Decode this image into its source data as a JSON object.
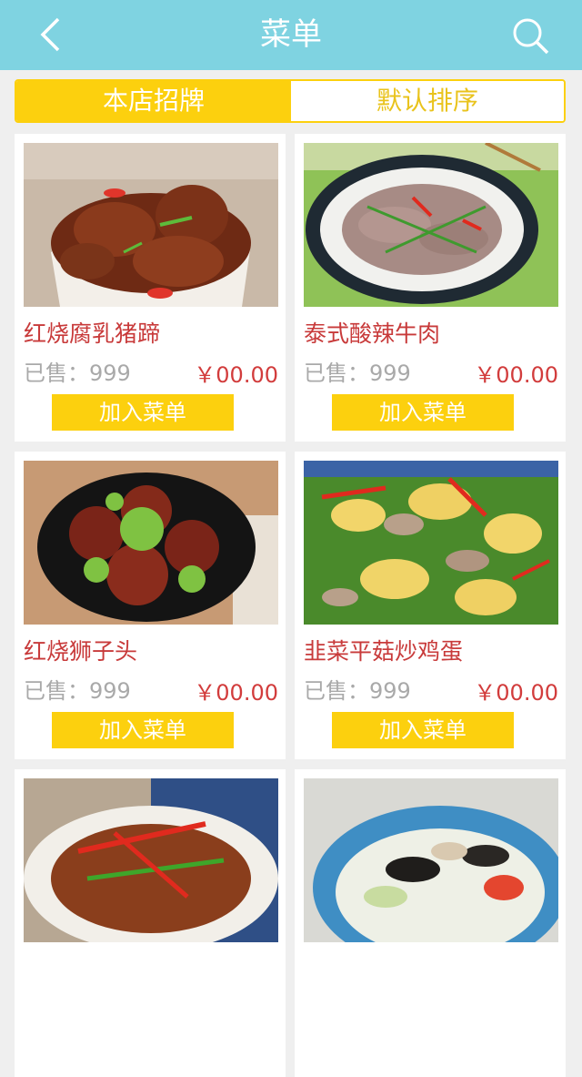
{
  "header": {
    "title": "菜单",
    "back_icon": "chevron-left-icon",
    "search_icon": "search-icon"
  },
  "tabs": [
    {
      "label": "本店招牌",
      "active": true
    },
    {
      "label": "默认排序",
      "active": false
    }
  ],
  "colors": {
    "header": "#7fd3e1",
    "accent": "#fcd00e",
    "name": "#c83a3a",
    "price": "#d23c3c",
    "muted": "#a9a9a9"
  },
  "dishes": [
    {
      "name": "红烧腐乳猪蹄",
      "sold": "已售：999",
      "price": "￥00.00",
      "button": "加入菜单"
    },
    {
      "name": "泰式酸辣牛肉",
      "sold": "已售：999",
      "price": "￥00.00",
      "button": "加入菜单"
    },
    {
      "name": "红烧狮子头",
      "sold": "已售：999",
      "price": "￥00.00",
      "button": "加入菜单"
    },
    {
      "name": "韭菜平菇炒鸡蛋",
      "sold": "已售：999",
      "price": "￥00.00",
      "button": "加入菜单"
    },
    {
      "name": "",
      "sold": "",
      "price": "",
      "button": ""
    },
    {
      "name": "",
      "sold": "",
      "price": "",
      "button": ""
    }
  ]
}
